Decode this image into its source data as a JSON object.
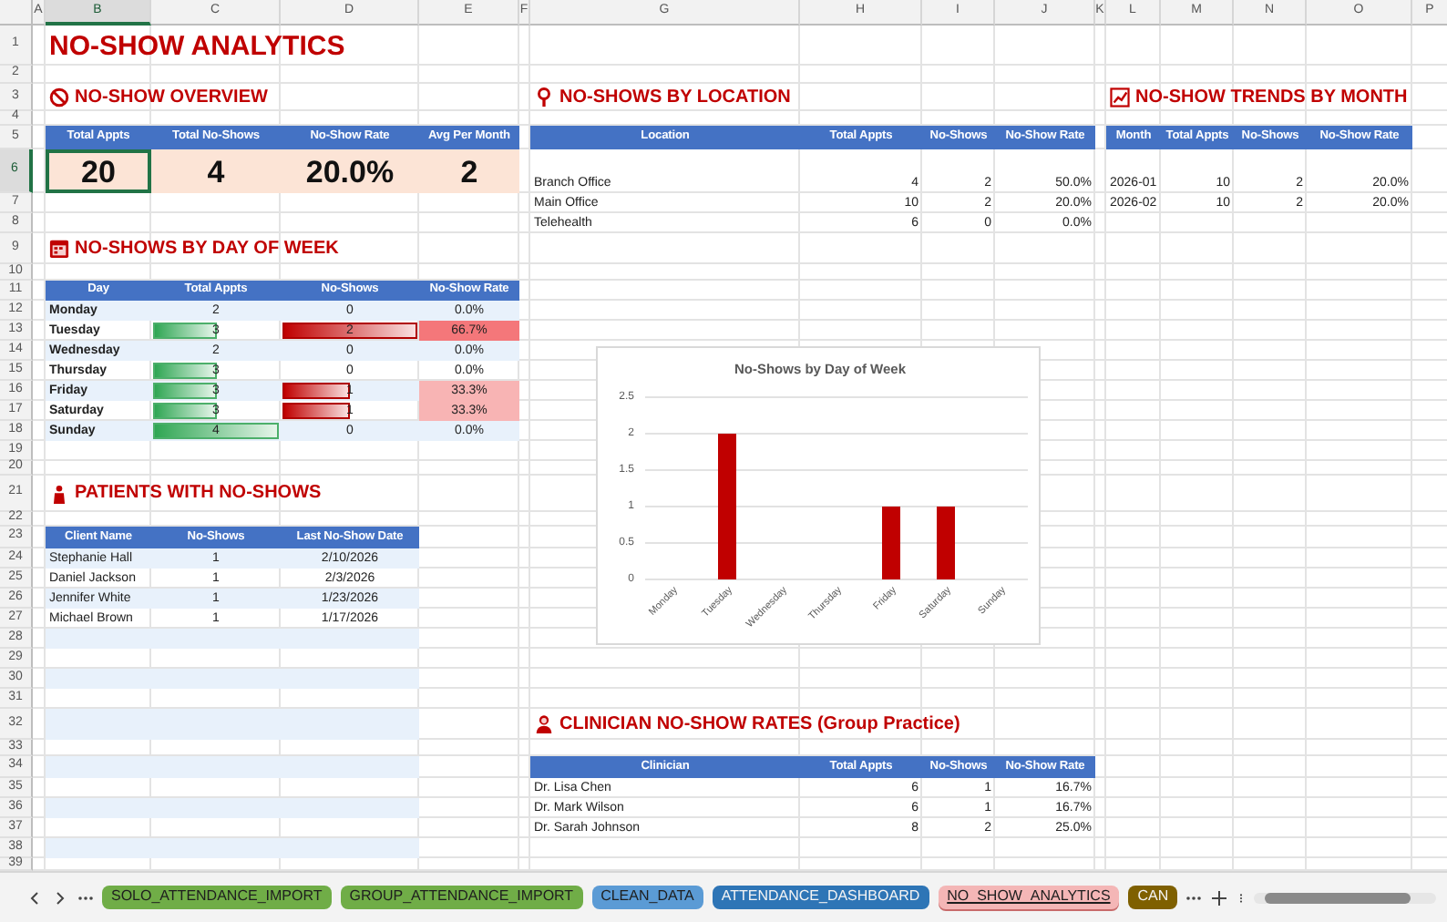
{
  "column_letters": [
    {
      "text": "A",
      "selected": false
    },
    {
      "text": "B",
      "selected": true
    },
    {
      "text": "C",
      "selected": false
    },
    {
      "text": "D",
      "selected": false
    },
    {
      "text": "E",
      "selected": false
    },
    {
      "text": "F",
      "selected": false
    },
    {
      "text": "G",
      "selected": false
    },
    {
      "text": "H",
      "selected": false
    },
    {
      "text": "I",
      "selected": false
    },
    {
      "text": "J",
      "selected": false
    },
    {
      "text": "K",
      "selected": false
    },
    {
      "text": "L",
      "selected": false
    },
    {
      "text": "M",
      "selected": false
    },
    {
      "text": "N",
      "selected": false
    },
    {
      "text": "O",
      "selected": false
    },
    {
      "text": "P",
      "selected": false
    }
  ],
  "row_numbers": [
    {
      "text": "1",
      "selected": false
    },
    {
      "text": "2",
      "selected": false
    },
    {
      "text": "3",
      "selected": false
    },
    {
      "text": "4",
      "selected": false
    },
    {
      "text": "5",
      "selected": false
    },
    {
      "text": "6",
      "selected": true
    },
    {
      "text": "7",
      "selected": false
    },
    {
      "text": "8",
      "selected": false
    },
    {
      "text": "9",
      "selected": false
    },
    {
      "text": "10",
      "selected": false
    },
    {
      "text": "11",
      "selected": false
    },
    {
      "text": "12",
      "selected": false
    },
    {
      "text": "13",
      "selected": false
    },
    {
      "text": "14",
      "selected": false
    },
    {
      "text": "15",
      "selected": false
    },
    {
      "text": "16",
      "selected": false
    },
    {
      "text": "17",
      "selected": false
    },
    {
      "text": "18",
      "selected": false
    },
    {
      "text": "19",
      "selected": false
    },
    {
      "text": "20",
      "selected": false
    },
    {
      "text": "21",
      "selected": false
    },
    {
      "text": "22",
      "selected": false
    },
    {
      "text": "23",
      "selected": false
    },
    {
      "text": "24",
      "selected": false
    },
    {
      "text": "25",
      "selected": false
    },
    {
      "text": "26",
      "selected": false
    },
    {
      "text": "27",
      "selected": false
    },
    {
      "text": "28",
      "selected": false
    },
    {
      "text": "29",
      "selected": false
    },
    {
      "text": "30",
      "selected": false
    },
    {
      "text": "31",
      "selected": false
    },
    {
      "text": "32",
      "selected": false
    },
    {
      "text": "33",
      "selected": false
    },
    {
      "text": "34",
      "selected": false
    },
    {
      "text": "35",
      "selected": false
    },
    {
      "text": "36",
      "selected": false
    },
    {
      "text": "37",
      "selected": false
    },
    {
      "text": "38",
      "selected": false
    },
    {
      "text": "39",
      "selected": false
    }
  ],
  "title": "NO-SHOW ANALYTICS",
  "overview": {
    "heading": "NO-SHOW OVERVIEW",
    "columns": [
      "Total Appts",
      "Total No-Shows",
      "No-Show Rate",
      "Avg Per Month"
    ],
    "values": [
      {
        "text": "20",
        "selected": true
      },
      {
        "text": "4",
        "selected": false
      },
      {
        "text": "20.0%",
        "selected": false
      },
      {
        "text": "2",
        "selected": false
      }
    ]
  },
  "day_of_week": {
    "heading": "NO-SHOWS BY DAY OF WEEK",
    "columns": [
      "Day",
      "Total Appts",
      "No-Shows",
      "No-Show Rate"
    ],
    "rows": [
      {
        "day": "Monday",
        "total": "2",
        "no_shows": "0",
        "rate": {
          "text": "0.0%"
        }
      },
      {
        "day": "Tuesday",
        "total": "3",
        "no_shows": "2",
        "rate": {
          "text": "66.7%",
          "color": "#f4777a"
        }
      },
      {
        "day": "Wednesday",
        "total": "2",
        "no_shows": "0",
        "rate": {
          "text": "0.0%"
        }
      },
      {
        "day": "Thursday",
        "total": "3",
        "no_shows": "0",
        "rate": {
          "text": "0.0%"
        }
      },
      {
        "day": "Friday",
        "total": "3",
        "no_shows": "1",
        "rate": {
          "text": "33.3%",
          "color": "#f8b4b4"
        }
      },
      {
        "day": "Saturday",
        "total": "3",
        "no_shows": "1",
        "rate": {
          "text": "33.3%",
          "color": "#f8b4b4"
        }
      },
      {
        "day": "Sunday",
        "total": "4",
        "no_shows": "0",
        "rate": {
          "text": "0.0%"
        }
      }
    ]
  },
  "patients": {
    "heading": "PATIENTS WITH NO-SHOWS",
    "columns": [
      "Client Name",
      "No-Shows",
      "Last No-Show Date"
    ],
    "rows": [
      {
        "name": "Stephanie Hall",
        "no_shows": "1",
        "last_date": "2/10/2026"
      },
      {
        "name": "Daniel Jackson",
        "no_shows": "1",
        "last_date": "2/3/2026"
      },
      {
        "name": "Jennifer White",
        "no_shows": "1",
        "last_date": "1/23/2026"
      },
      {
        "name": "Michael Brown",
        "no_shows": "1",
        "last_date": "1/17/2026"
      }
    ]
  },
  "location": {
    "heading": "NO-SHOWS BY LOCATION",
    "columns": [
      "Location",
      "Total Appts",
      "No-Shows",
      "No-Show Rate"
    ],
    "rows": [
      {
        "location": "Branch Office",
        "total": "4",
        "no_shows": "2",
        "rate": "50.0%"
      },
      {
        "location": "Main Office",
        "total": "10",
        "no_shows": "2",
        "rate": "20.0%"
      },
      {
        "location": "Telehealth",
        "total": "6",
        "no_shows": "0",
        "rate": "0.0%"
      }
    ]
  },
  "trends": {
    "heading": "NO-SHOW TRENDS BY MONTH",
    "columns": [
      "Month",
      "Total Appts",
      "No-Shows",
      "No-Show Rate"
    ],
    "rows": [
      {
        "month": "2026-01",
        "total": "10",
        "no_shows": "2",
        "rate": "20.0%"
      },
      {
        "month": "2026-02",
        "total": "10",
        "no_shows": "2",
        "rate": "20.0%"
      }
    ]
  },
  "chart": {
    "chart_data": {
      "type": "bar",
      "title": "No-Shows by Day of Week",
      "categories": [
        "Monday",
        "Tuesday",
        "Wednesday",
        "Thursday",
        "Friday",
        "Saturday",
        "Sunday"
      ],
      "series": [
        {
          "color": "#c00000",
          "values": [
            0,
            2,
            0,
            0,
            1,
            1,
            0
          ]
        }
      ],
      "ylim": [
        0,
        2.5
      ],
      "grid": true,
      "yticks": [
        0,
        0.5,
        1,
        1.5,
        2,
        2.5
      ]
    }
  },
  "clinician": {
    "heading": "CLINICIAN NO-SHOW RATES (Group Practice)",
    "columns": [
      "Clinician",
      "Total Appts",
      "No-Shows",
      "No-Show Rate"
    ],
    "rows": [
      {
        "clinician": "Dr. Lisa Chen",
        "total": "6",
        "no_shows": "1",
        "rate": "16.7%"
      },
      {
        "clinician": "Dr. Mark Wilson",
        "total": "6",
        "no_shows": "1",
        "rate": "16.7%"
      },
      {
        "clinician": "Dr. Sarah Johnson",
        "total": "8",
        "no_shows": "2",
        "rate": "25.0%"
      }
    ]
  },
  "sheet_tabs": [
    {
      "label": "SOLO_ATTENDANCE_IMPORT",
      "color": "#70ad47",
      "selected": false
    },
    {
      "label": "GROUP_ATTENDANCE_IMPORT",
      "color": "#70ad47",
      "selected": false
    },
    {
      "label": "CLEAN_DATA",
      "color": "#5b9bd5",
      "selected": false
    },
    {
      "label": "ATTENDANCE_DASHBOARD",
      "color": "#2e75b6",
      "selected": false
    },
    {
      "label": "NO_SHOW_ANALYTICS",
      "color": "#f4b6b6",
      "selected": true
    },
    {
      "label": "CAN",
      "color": "#7f6000",
      "selected": false
    }
  ]
}
